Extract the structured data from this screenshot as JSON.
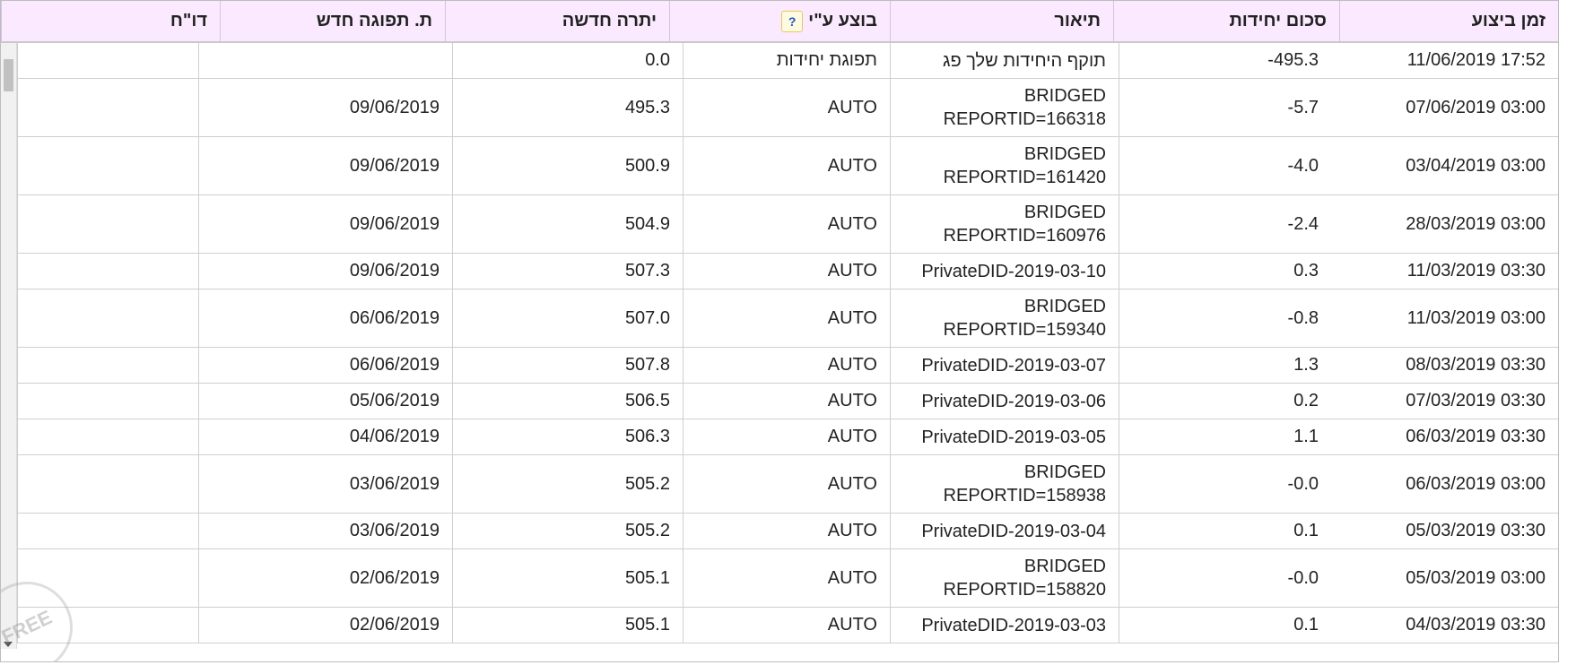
{
  "headers": {
    "time": "זמן ביצוע",
    "units_total": "סכום יחידות",
    "description": "תיאור",
    "performed_by": "בוצע ע\"י",
    "new_balance": "יתרה חדשה",
    "new_expiry": "ת. תפוגה חדש",
    "report": "דו\"ח"
  },
  "help_icon": "?",
  "rows": [
    {
      "time": "11/06/2019 17:52",
      "units": "-495.3",
      "description": "תוקף היחידות שלך פג",
      "by": "תפוגת יחידות",
      "balance": "0.0",
      "expiry": "",
      "report": ""
    },
    {
      "time": "07/06/2019 03:00",
      "units": "-5.7",
      "description": "BRIDGED REPORTID=166318",
      "by": "AUTO",
      "balance": "495.3",
      "expiry": "09/06/2019",
      "report": ""
    },
    {
      "time": "03/04/2019 03:00",
      "units": "-4.0",
      "description": "BRIDGED REPORTID=161420",
      "by": "AUTO",
      "balance": "500.9",
      "expiry": "09/06/2019",
      "report": ""
    },
    {
      "time": "28/03/2019 03:00",
      "units": "-2.4",
      "description": "BRIDGED REPORTID=160976",
      "by": "AUTO",
      "balance": "504.9",
      "expiry": "09/06/2019",
      "report": ""
    },
    {
      "time": "11/03/2019 03:30",
      "units": "0.3",
      "description": "PrivateDID-2019-03-10",
      "by": "AUTO",
      "balance": "507.3",
      "expiry": "09/06/2019",
      "report": ""
    },
    {
      "time": "11/03/2019 03:00",
      "units": "-0.8",
      "description": "BRIDGED REPORTID=159340",
      "by": "AUTO",
      "balance": "507.0",
      "expiry": "06/06/2019",
      "report": ""
    },
    {
      "time": "08/03/2019 03:30",
      "units": "1.3",
      "description": "PrivateDID-2019-03-07",
      "by": "AUTO",
      "balance": "507.8",
      "expiry": "06/06/2019",
      "report": ""
    },
    {
      "time": "07/03/2019 03:30",
      "units": "0.2",
      "description": "PrivateDID-2019-03-06",
      "by": "AUTO",
      "balance": "506.5",
      "expiry": "05/06/2019",
      "report": ""
    },
    {
      "time": "06/03/2019 03:30",
      "units": "1.1",
      "description": "PrivateDID-2019-03-05",
      "by": "AUTO",
      "balance": "506.3",
      "expiry": "04/06/2019",
      "report": ""
    },
    {
      "time": "06/03/2019 03:00",
      "units": "-0.0",
      "description": "BRIDGED REPORTID=158938",
      "by": "AUTO",
      "balance": "505.2",
      "expiry": "03/06/2019",
      "report": ""
    },
    {
      "time": "05/03/2019 03:30",
      "units": "0.1",
      "description": "PrivateDID-2019-03-04",
      "by": "AUTO",
      "balance": "505.2",
      "expiry": "03/06/2019",
      "report": ""
    },
    {
      "time": "05/03/2019 03:00",
      "units": "-0.0",
      "description": "BRIDGED REPORTID=158820",
      "by": "AUTO",
      "balance": "505.1",
      "expiry": "02/06/2019",
      "report": ""
    },
    {
      "time": "04/03/2019 03:30",
      "units": "0.1",
      "description": "PrivateDID-2019-03-03",
      "by": "AUTO",
      "balance": "505.1",
      "expiry": "02/06/2019",
      "report": ""
    }
  ],
  "watermark": "FREE",
  "colors": {
    "header_bg": "#fbeaff",
    "grid": "#cfcfcf",
    "help_border": "#e6c866",
    "help_text": "#1a56c4"
  }
}
